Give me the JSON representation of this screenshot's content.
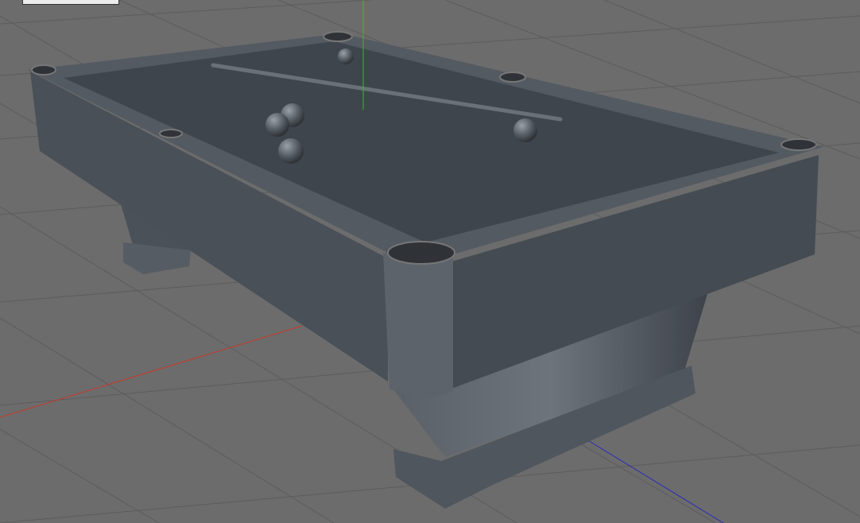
{
  "viewport": {
    "background": "#6c6c6c",
    "grid_color": "#5e5e5e",
    "axis_colors": {
      "x": "#c83a2a",
      "y": "#2fbf2f",
      "z": "#2a2ab8"
    },
    "object": "pool-table",
    "object_color": "#4a5058"
  }
}
